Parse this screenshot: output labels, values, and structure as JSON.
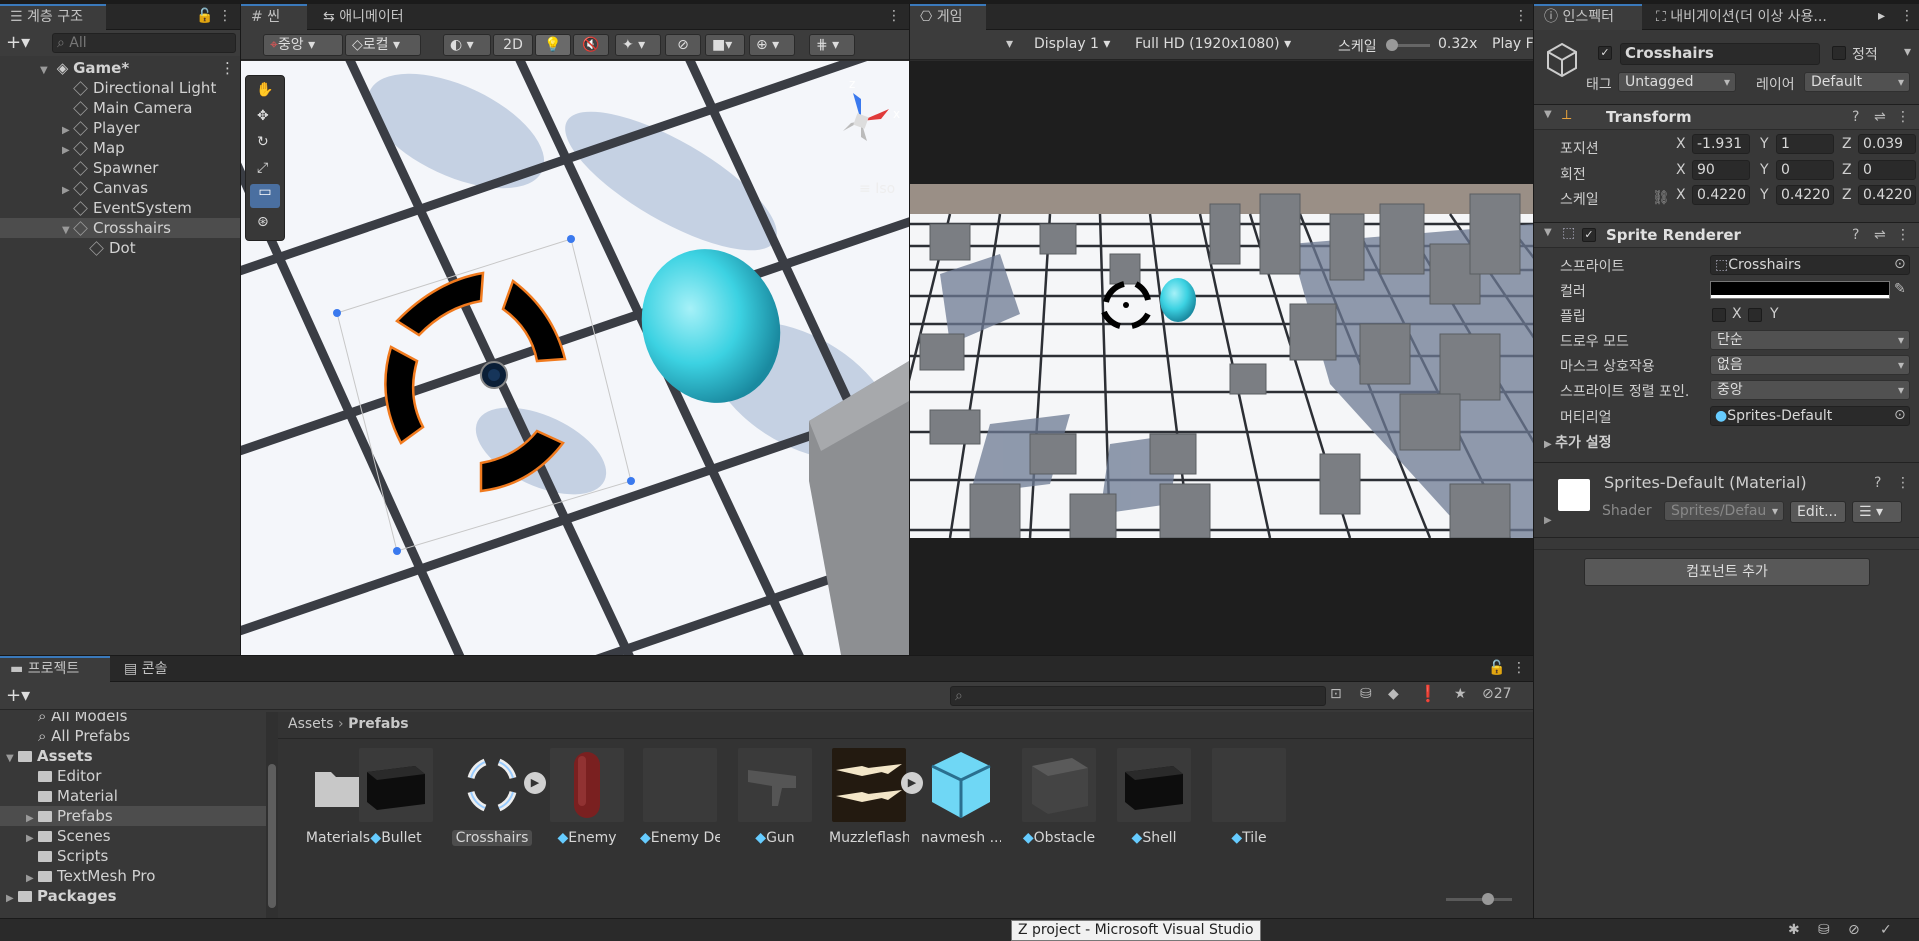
{
  "hierarchy": {
    "tab_label": "계층 구조",
    "search_placeholder": "All",
    "scene_name": "Game*",
    "items": [
      {
        "label": "Directional Light",
        "indent": 1,
        "arrow": false
      },
      {
        "label": "Main Camera",
        "indent": 1,
        "arrow": false
      },
      {
        "label": "Player",
        "indent": 1,
        "arrow": true
      },
      {
        "label": "Map",
        "indent": 1,
        "arrow": true
      },
      {
        "label": "Spawner",
        "indent": 1,
        "arrow": false
      },
      {
        "label": "Canvas",
        "indent": 1,
        "arrow": true
      },
      {
        "label": "EventSystem",
        "indent": 1,
        "arrow": false
      },
      {
        "label": "Crosshairs",
        "indent": 1,
        "arrow": true,
        "expanded": true,
        "selected": true
      },
      {
        "label": "Dot",
        "indent": 2,
        "arrow": false
      }
    ]
  },
  "scene": {
    "tab_scene": "씬",
    "tab_animator": "애니메이터",
    "pivot_label": "중앙",
    "space_label": "로컬",
    "mode_2d": "2D",
    "iso_label": "Iso",
    "gizmo_axes": {
      "z": "z",
      "x": "x"
    }
  },
  "game": {
    "tab_label": "게임",
    "display": "Display 1",
    "resolution": "Full HD (1920x1080)",
    "scale_label": "스케일",
    "scale_value": "0.32x",
    "play_label": "Play F"
  },
  "inspector": {
    "tab_label": "인스펙터",
    "tab_nav": "내비게이션(더 이상 사용...",
    "object_name": "Crosshairs",
    "static_label": "정적",
    "tag_label": "태그",
    "tag_value": "Untagged",
    "layer_label": "레이어",
    "layer_value": "Default",
    "transform": {
      "title": "Transform",
      "position_label": "포지션",
      "rotation_label": "회전",
      "scale_label": "스케일",
      "position": {
        "x": "-1.931",
        "y": "1",
        "z": "0.039"
      },
      "rotation": {
        "x": "90",
        "y": "0",
        "z": "0"
      },
      "scale": {
        "x": "0.4220",
        "y": "0.4220",
        "z": "0.4220"
      }
    },
    "sprite_renderer": {
      "title": "Sprite Renderer",
      "sprite_label": "스프라이트",
      "sprite_value": "Crosshairs",
      "color_label": "컬러",
      "flip_label": "플립",
      "flip_x": "X",
      "flip_y": "Y",
      "draw_mode_label": "드로우 모드",
      "draw_mode_value": "단순",
      "mask_label": "마스크 상호작용",
      "mask_value": "없음",
      "sort_point_label": "스프라이트 정렬 포인.",
      "sort_point_value": "중앙",
      "material_label": "머티리얼",
      "material_value": "Sprites-Default",
      "extra_label": "추가 설정"
    },
    "material": {
      "title": "Sprites-Default (Material)",
      "shader_label": "Shader",
      "shader_value": "Sprites/Defau",
      "edit_label": "Edit..."
    },
    "add_component": "컴포넌트 추가"
  },
  "project": {
    "tab_project": "프로젝트",
    "tab_console": "콘솔",
    "hidden_count": "27",
    "tree": [
      {
        "label": "All Models",
        "indent": 1,
        "type": "search",
        "cut": true
      },
      {
        "label": "All Prefabs",
        "indent": 1,
        "type": "search"
      },
      {
        "label": "Assets",
        "indent": 0,
        "type": "folder",
        "bold": true,
        "arrow": "down"
      },
      {
        "label": "Editor",
        "indent": 1,
        "type": "folder"
      },
      {
        "label": "Material",
        "indent": 1,
        "type": "folder"
      },
      {
        "label": "Prefabs",
        "indent": 1,
        "type": "folder",
        "arrow": "right",
        "selected": true
      },
      {
        "label": "Scenes",
        "indent": 1,
        "type": "folder",
        "arrow": "right"
      },
      {
        "label": "Scripts",
        "indent": 1,
        "type": "folder"
      },
      {
        "label": "TextMesh Pro",
        "indent": 1,
        "type": "folder",
        "arrow": "right"
      },
      {
        "label": "Packages",
        "indent": 0,
        "type": "folder",
        "bold": true,
        "arrow": "right"
      }
    ],
    "breadcrumb": {
      "root": "Assets",
      "current": "Prefabs"
    },
    "assets": [
      {
        "name": "Materials",
        "kind": "folder"
      },
      {
        "name": "Bullet",
        "kind": "black-box"
      },
      {
        "name": "Crosshairs",
        "kind": "crosshair",
        "selected": true,
        "play": true
      },
      {
        "name": "Enemy",
        "kind": "capsule"
      },
      {
        "name": "Enemy De...",
        "kind": "empty"
      },
      {
        "name": "Gun",
        "kind": "gun"
      },
      {
        "name": "Muzzleflash",
        "kind": "flash",
        "play": true
      },
      {
        "name": "navmesh ...",
        "kind": "blue-cube"
      },
      {
        "name": "Obstacle",
        "kind": "grey-box"
      },
      {
        "name": "Shell",
        "kind": "black-box"
      },
      {
        "name": "Tile",
        "kind": "empty"
      }
    ]
  },
  "taskbar_tooltip": "Z project - Microsoft Visual Studio",
  "colors": {
    "accent": "#3a79bb",
    "selection": "#4d4d4d",
    "panel": "#383838",
    "orange": "#f07a1e",
    "cyan": "#3fd0e0"
  }
}
